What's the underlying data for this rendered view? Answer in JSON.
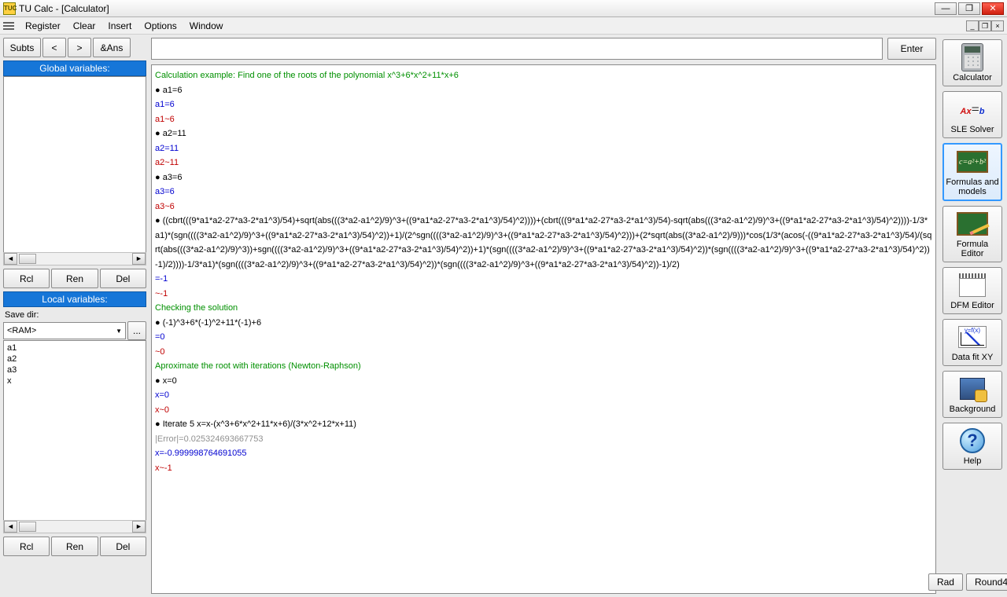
{
  "window": {
    "title": "TU Calc - [Calculator]"
  },
  "menu": {
    "items": [
      "Register",
      "Clear",
      "Insert",
      "Options",
      "Window"
    ]
  },
  "toolbar": {
    "subts": "Subts",
    "prev": "<",
    "next": ">",
    "ans": "&Ans",
    "enter": "Enter"
  },
  "global": {
    "header": "Global variables:",
    "rcl": "Rcl",
    "ren": "Ren",
    "del": "Del"
  },
  "local": {
    "header": "Local variables:",
    "save_dir_label": "Save dir:",
    "save_dir_value": "<RAM>",
    "browse": "...",
    "items": [
      "a1",
      "a2",
      "a3",
      "x"
    ],
    "rcl": "Rcl",
    "ren": "Ren",
    "del": "Del"
  },
  "output_lines": [
    {
      "cls": "green",
      "t": "Calculation example: Find one of the roots of the polynomial x^3+6*x^2+11*x+6"
    },
    {
      "cls": "black",
      "t": "● a1=6"
    },
    {
      "cls": "blue",
      "t": "a1=6"
    },
    {
      "cls": "red",
      "t": "a1~6"
    },
    {
      "cls": "black",
      "t": "● a2=11"
    },
    {
      "cls": "blue",
      "t": "a2=11"
    },
    {
      "cls": "red",
      "t": "a2~11"
    },
    {
      "cls": "black",
      "t": "● a3=6"
    },
    {
      "cls": "blue",
      "t": "a3=6"
    },
    {
      "cls": "red",
      "t": "a3~6"
    },
    {
      "cls": "black",
      "t": "● ((cbrt(((9*a1*a2-27*a3-2*a1^3)/54)+sqrt(abs(((3*a2-a1^2)/9)^3+((9*a1*a2-27*a3-2*a1^3)/54)^2))))+(cbrt(((9*a1*a2-27*a3-2*a1^3)/54)-sqrt(abs(((3*a2-a1^2)/9)^3+((9*a1*a2-27*a3-2*a1^3)/54)^2))))-1/3*a1)*(sgn((((3*a2-a1^2)/9)^3+((9*a1*a2-27*a3-2*a1^3)/54)^2))+1)/(2^sgn((((3*a2-a1^2)/9)^3+((9*a1*a2-27*a3-2*a1^3)/54)^2)))+(2*sqrt(abs((3*a2-a1^2)/9)))*cos(1/3*(acos(-((9*a1*a2-27*a3-2*a1^3)/54)/(sqrt(abs(((3*a2-a1^2)/9)^3))+sgn((((3*a2-a1^2)/9)^3+((9*a1*a2-27*a3-2*a1^3)/54)^2))+1)*(sgn((((3*a2-a1^2)/9)^3+((9*a1*a2-27*a3-2*a1^3)/54)^2))*(sgn((((3*a2-a1^2)/9)^3+((9*a1*a2-27*a3-2*a1^3)/54)^2))-1)/2))))-1/3*a1)*(sgn((((3*a2-a1^2)/9)^3+((9*a1*a2-27*a3-2*a1^3)/54)^2))*(sgn((((3*a2-a1^2)/9)^3+((9*a1*a2-27*a3-2*a1^3)/54)^2))-1)/2)"
    },
    {
      "cls": "blue",
      "t": "=-1"
    },
    {
      "cls": "red",
      "t": "~-1"
    },
    {
      "cls": "green",
      "t": "Checking the solution"
    },
    {
      "cls": "black",
      "t": "● (-1)^3+6*(-1)^2+11*(-1)+6"
    },
    {
      "cls": "blue",
      "t": "=0"
    },
    {
      "cls": "red",
      "t": "~0"
    },
    {
      "cls": "green",
      "t": "Aproximate the root with iterations (Newton-Raphson)"
    },
    {
      "cls": "black",
      "t": "● x=0"
    },
    {
      "cls": "blue",
      "t": "x=0"
    },
    {
      "cls": "red",
      "t": "x~0"
    },
    {
      "cls": "black",
      "t": "● Iterate 5 x=x-(x^3+6*x^2+11*x+6)/(3*x^2+12*x+11)"
    },
    {
      "cls": "gray",
      "t": "|Error|=0.025324693667753"
    },
    {
      "cls": "blue",
      "t": "x=-0.999998764691055"
    },
    {
      "cls": "red",
      "t": "x~-1"
    }
  ],
  "tools": {
    "calculator": "Calculator",
    "sle": "SLE Solver",
    "formulas": "Formulas and models",
    "editor": "Formula Editor",
    "dfm": "DFM Editor",
    "fit": "Data fit XY",
    "background": "Background",
    "help": "Help"
  },
  "status": {
    "rad": "Rad",
    "round": "Round4"
  }
}
